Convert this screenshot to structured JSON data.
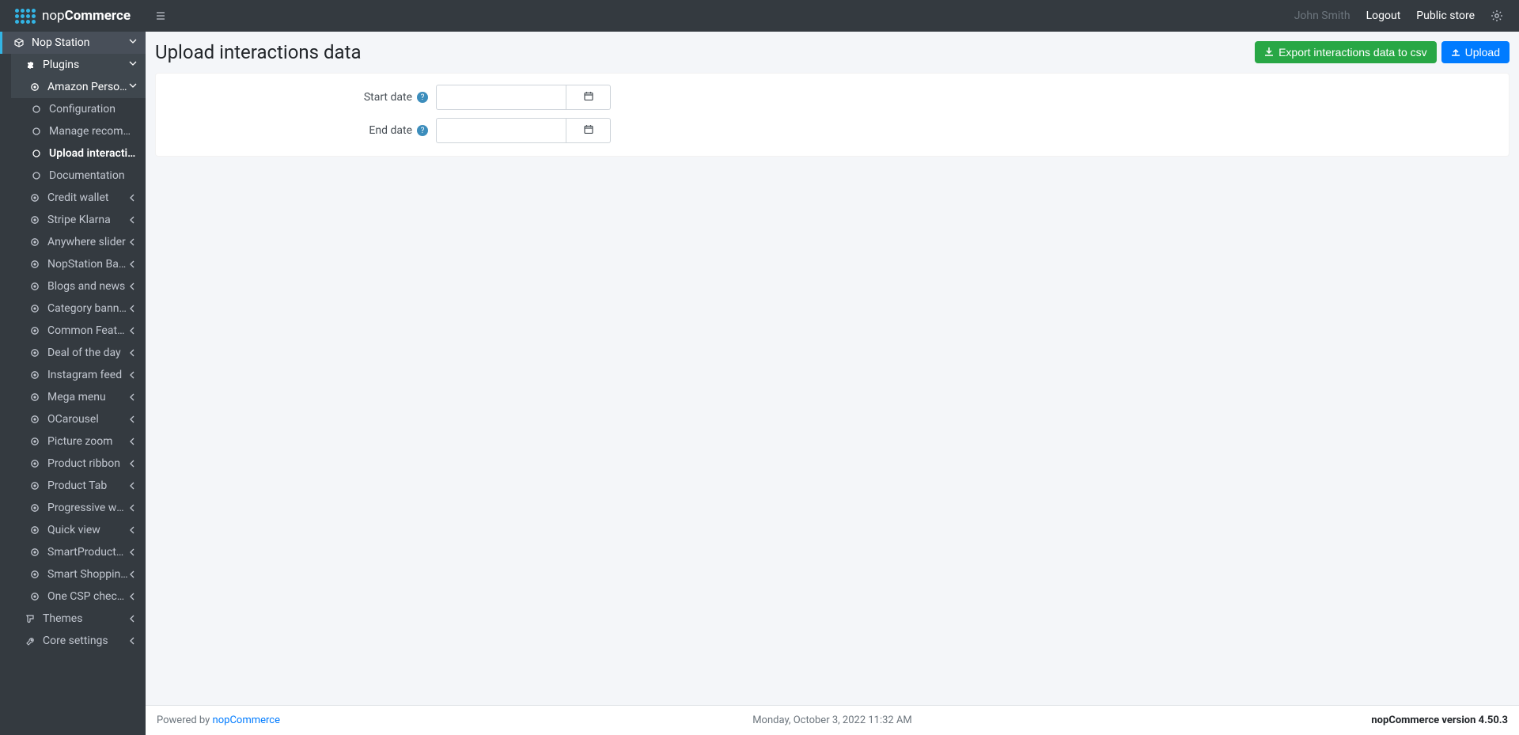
{
  "brand_text_1": "nop",
  "brand_text_2": "Commerce",
  "header": {
    "user": "John Smith",
    "logout": "Logout",
    "public_store": "Public store"
  },
  "page": {
    "title": "Upload interactions data",
    "buttons": {
      "export": "Export interactions data to csv",
      "upload": "Upload"
    },
    "fields": {
      "start_date_label": "Start date",
      "end_date_label": "End date"
    }
  },
  "sidebar": {
    "nop_station": "Nop Station",
    "plugins": "Plugins",
    "amazon_personalize": "Amazon Personalize",
    "configuration": "Configuration",
    "manage_recommenders": "Manage recommenders",
    "upload_interactions": "Upload interactions data",
    "documentation": "Documentation",
    "rest": [
      "Credit wallet",
      "Stripe Klarna",
      "Anywhere slider",
      "NopStation Banner",
      "Blogs and news",
      "Category banner",
      "Common Features",
      "Deal of the day",
      "Instagram feed",
      "Mega menu",
      "OCarousel",
      "Picture zoom",
      "Product ribbon",
      "Product Tab",
      "Progressive web app",
      "Quick view",
      "SmartProductBox",
      "Smart Shopping Cart",
      "One CSP checkout"
    ],
    "themes": "Themes",
    "core_settings": "Core settings"
  },
  "footer": {
    "powered_by": "Powered by ",
    "powered_link": "nopCommerce",
    "date": "Monday, October 3, 2022 11:32 AM",
    "version_label": "nopCommerce version ",
    "version": "4.50.3"
  }
}
